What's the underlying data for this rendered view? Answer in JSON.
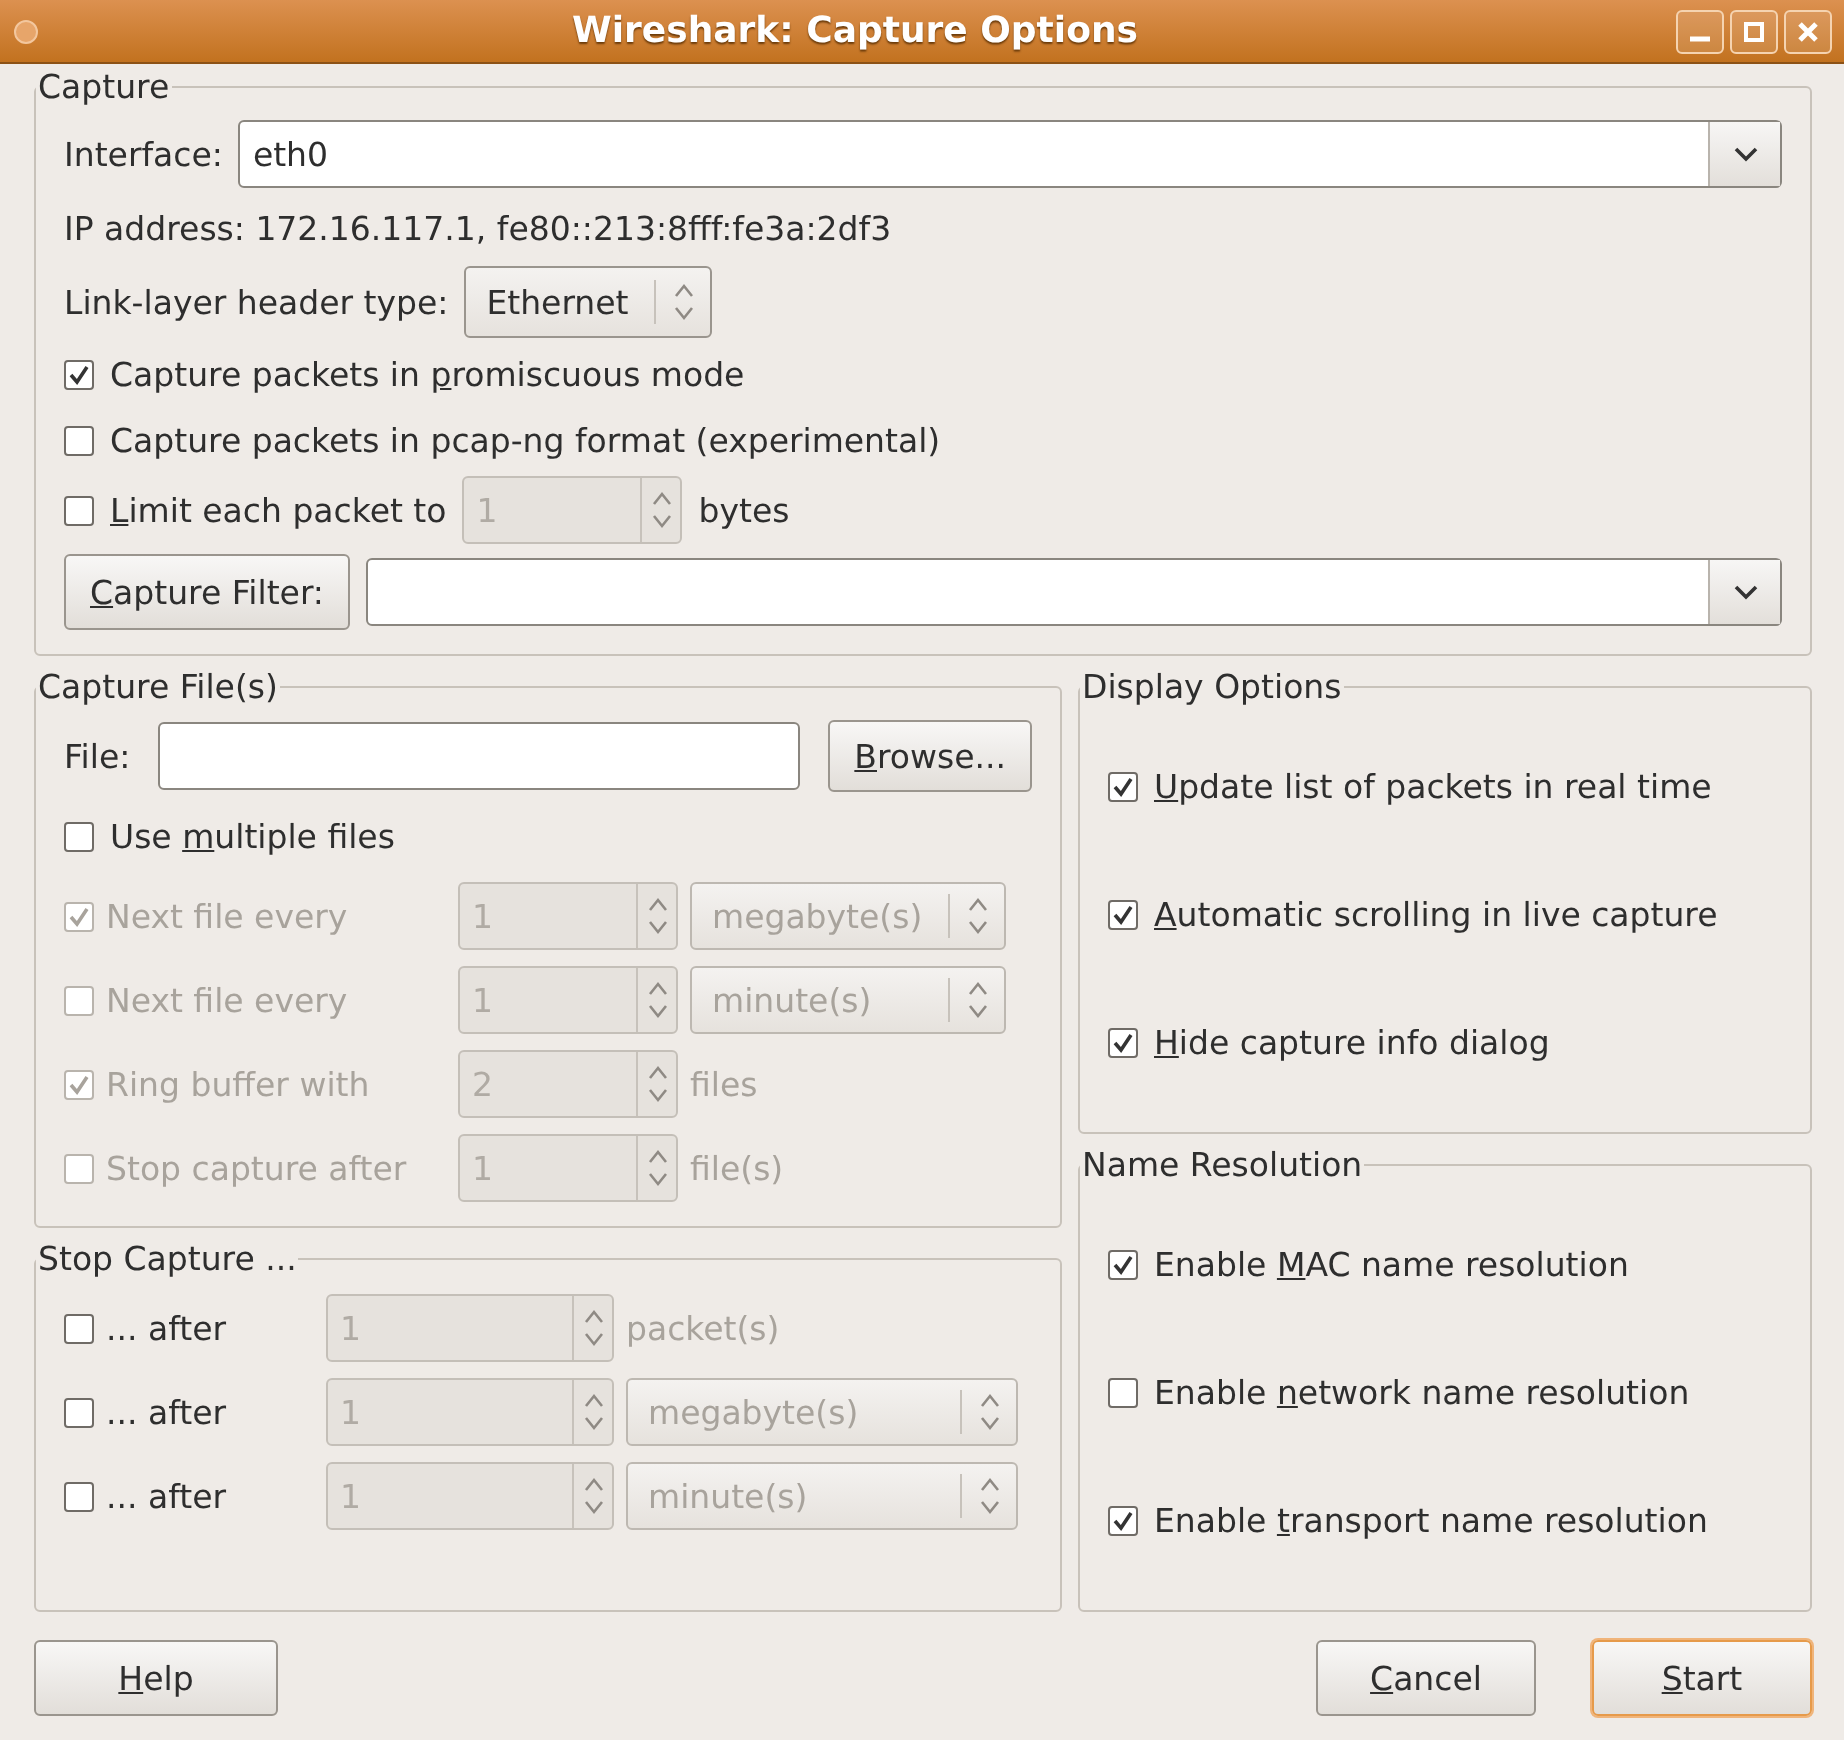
{
  "window": {
    "title": "Wireshark: Capture Options"
  },
  "capture": {
    "title": "Capture",
    "interface": {
      "label": "Interface:",
      "value": "eth0"
    },
    "ip_address": "IP address: 172.16.117.1, fe80::213:8fff:fe3a:2df3",
    "link_layer": {
      "label": "Link-layer header type:",
      "value": "Ethernet"
    },
    "options": [
      {
        "label": {
          "pre": "Capture packets in ",
          "key": "p",
          "post": "romiscuous mode"
        },
        "checked": true
      },
      {
        "label": {
          "pre": "Capture packets in pcap-ng format (experimental)"
        },
        "checked": false
      }
    ],
    "limit": {
      "label": {
        "key": "L",
        "post": "imit each packet to"
      },
      "checked": false,
      "value": "1",
      "unit": "bytes",
      "disabled": true
    },
    "filter": {
      "button": {
        "key": "C",
        "post": "apture Filter:"
      }
    }
  },
  "capture_files": {
    "title": "Capture File(s)",
    "file_label": "File:",
    "browse": {
      "key": "B",
      "post": "rowse..."
    },
    "multiple": {
      "label": {
        "pre": "Use ",
        "key": "m",
        "post": "ultiple files"
      },
      "checked": false
    },
    "rows": [
      {
        "kind": "combo",
        "label": "Next file every",
        "checked": true,
        "disabled": true,
        "value": "1",
        "unit": "megabyte(s)"
      },
      {
        "kind": "combo",
        "label": "Next file every",
        "checked": false,
        "disabled": true,
        "value": "1",
        "unit": "minute(s)"
      },
      {
        "kind": "text",
        "label": "Ring buffer with",
        "checked": true,
        "disabled": true,
        "value": "2",
        "unit": "files"
      },
      {
        "kind": "text",
        "label": "Stop capture after",
        "checked": false,
        "disabled": true,
        "value": "1",
        "unit": "file(s)"
      }
    ]
  },
  "stop_capture": {
    "title": "Stop Capture ...",
    "rows": [
      {
        "kind": "text",
        "label": "... after",
        "checked": false,
        "disabled": false,
        "spin": {
          "value": "1",
          "disabled": true
        },
        "unit": "packet(s)"
      },
      {
        "kind": "combo",
        "label": "... after",
        "checked": false,
        "disabled": false,
        "spin": {
          "value": "1",
          "disabled": true
        },
        "unit": "megabyte(s)"
      },
      {
        "kind": "combo",
        "label": "... after",
        "checked": false,
        "disabled": false,
        "spin": {
          "value": "1",
          "disabled": true
        },
        "unit": "minute(s)"
      }
    ]
  },
  "display_options": {
    "title": "Display Options",
    "items": [
      {
        "label": {
          "key": "U",
          "post": "pdate list of packets in real time"
        },
        "checked": true
      },
      {
        "label": {
          "key": "A",
          "post": "utomatic scrolling in live capture"
        },
        "checked": true
      },
      {
        "label": {
          "key": "H",
          "post": "ide capture info dialog"
        },
        "checked": true
      }
    ]
  },
  "name_resolution": {
    "title": "Name Resolution",
    "items": [
      {
        "label": {
          "pre": "Enable ",
          "key": "M",
          "post": "AC name resolution"
        },
        "checked": true
      },
      {
        "label": {
          "pre": "Enable ",
          "key": "n",
          "post": "etwork name resolution"
        },
        "checked": false
      },
      {
        "label": {
          "pre": "Enable ",
          "key": "t",
          "post": "ransport name resolution"
        },
        "checked": true
      }
    ]
  },
  "buttons_left": [
    {
      "label": {
        "key": "H",
        "post": "elp"
      },
      "default": false
    }
  ],
  "buttons_right": [
    {
      "label": {
        "key": "C",
        "post": "ancel"
      },
      "default": false
    },
    {
      "label": {
        "key": "S",
        "post": "tart"
      },
      "default": true
    }
  ]
}
